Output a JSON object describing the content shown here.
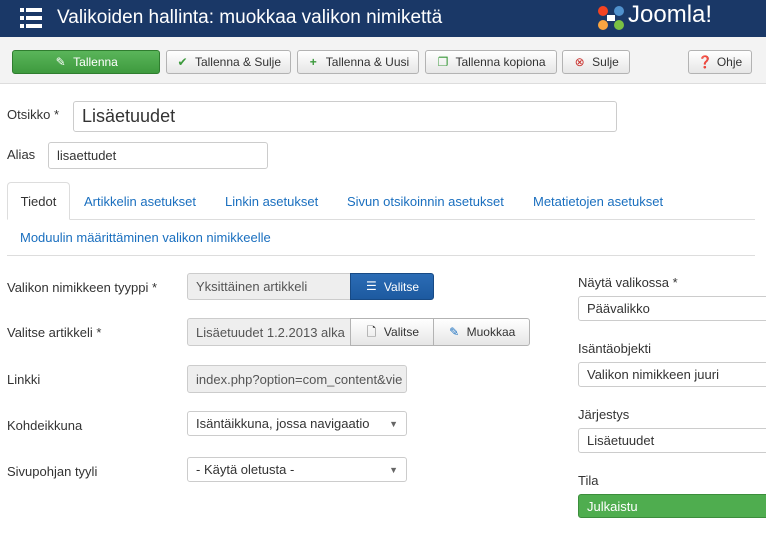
{
  "header": {
    "title": "Valikoiden hallinta: muokkaa valikon nimikettä",
    "logo_text": "Joomla!"
  },
  "toolbar": {
    "save": "Tallenna",
    "save_close": "Tallenna & Sulje",
    "save_new": "Tallenna & Uusi",
    "save_copy": "Tallenna kopiona",
    "close": "Sulje",
    "help": "Ohje"
  },
  "form": {
    "title_label": "Otsikko *",
    "title_value": "Lisäetuudet",
    "alias_label": "Alias",
    "alias_value": "lisaettudet"
  },
  "tabs": [
    {
      "label": "Tiedot"
    },
    {
      "label": "Artikkelin asetukset"
    },
    {
      "label": "Linkin asetukset"
    },
    {
      "label": "Sivun otsikoinnin asetukset"
    },
    {
      "label": "Metatietojen asetukset"
    },
    {
      "label": "Moduulin määrittäminen valikon nimikkeelle"
    }
  ],
  "details": {
    "type_label": "Valikon nimikkeen tyyppi *",
    "type_value": "Yksittäinen artikkeli",
    "type_button": "Valitse",
    "article_label": "Valitse artikkeli *",
    "article_value": "Lisäetuudet 1.2.2013 alka",
    "article_select": "Valitse",
    "article_edit": "Muokkaa",
    "link_label": "Linkki",
    "link_value": "index.php?option=com_content&vie",
    "target_label": "Kohdeikkuna",
    "target_value": "Isäntäikkuna, jossa navigaatio",
    "template_label": "Sivupohjan tyyli",
    "template_value": "- Käytä oletusta -"
  },
  "sidebar": {
    "menu_label": "Näytä valikossa *",
    "menu_value": "Päävalikko",
    "parent_label": "Isäntäobjekti",
    "parent_value": "Valikon nimikkeen juuri",
    "order_label": "Järjestys",
    "order_value": "Lisäetuudet",
    "status_label": "Tila",
    "status_value": "Julkaistu"
  },
  "colors": {
    "header_bg": "#1a3867",
    "save_green": "#46a546",
    "link_blue": "#1a6fbf",
    "select_blue": "#2b6cb5"
  }
}
